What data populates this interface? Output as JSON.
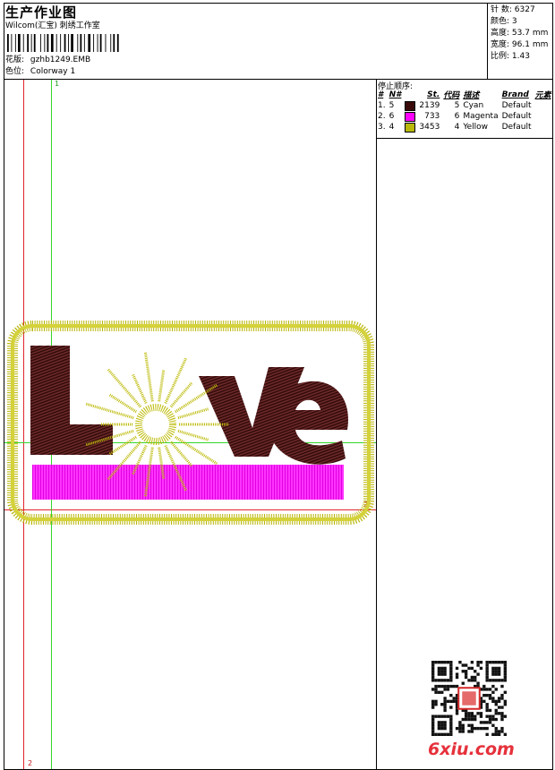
{
  "header": {
    "title": "生产作业图",
    "company": "Wilcom(汇宝) 刺绣工作室",
    "design_label": "花版:",
    "design_file": "gzhb1249.EMB",
    "colorway_label": "色位:",
    "colorway": "Colorway 1"
  },
  "stats": [
    {
      "label": "针 数:",
      "value": "6327"
    },
    {
      "label": "颜色:",
      "value": "3"
    },
    {
      "label": "高度:",
      "value": "53.7 mm"
    },
    {
      "label": "宽度:",
      "value": "96.1 mm"
    },
    {
      "label": "比例:",
      "value": "1.43"
    }
  ],
  "stop_sequence": {
    "title": "停止顺序:",
    "headers": [
      "#",
      "N#",
      "St.",
      "代码",
      "描述",
      "Brand",
      "元素"
    ],
    "rows": [
      {
        "seq": "1.",
        "needle": "5",
        "color": "#3a0a0a",
        "stitches": "2139",
        "code": "5",
        "desc": "Cyan",
        "brand": "Default"
      },
      {
        "seq": "2.",
        "needle": "6",
        "color": "#ff00ff",
        "stitches": "733",
        "code": "6",
        "desc": "Magenta",
        "brand": "Default"
      },
      {
        "seq": "3.",
        "needle": "4",
        "color": "#b9b80a",
        "stitches": "3453",
        "code": "4",
        "desc": "Yellow",
        "brand": "Default"
      }
    ]
  },
  "markers": {
    "green_top": "1",
    "red_right": "2",
    "red_bottom": "2"
  },
  "design_text": "Love",
  "watermark": "6xiu.com"
}
